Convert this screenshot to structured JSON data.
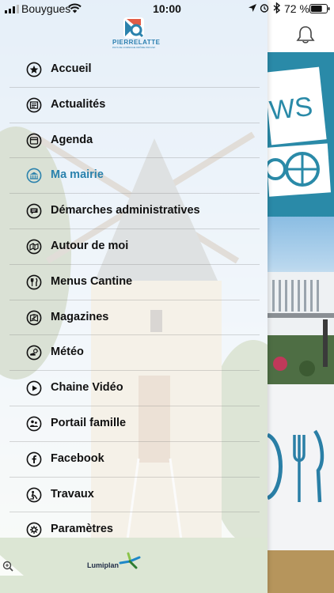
{
  "status_bar": {
    "carrier": "Bouygues",
    "time": "10:00",
    "battery_percent": "72 %",
    "battery_level": 0.72
  },
  "brand": {
    "name": "PIERRELATTE",
    "tagline": "PAYS DE CORNICHE DRÔME PROVENÇALE",
    "accent_color": "#2b82ad"
  },
  "menu": {
    "items": [
      {
        "label": "Accueil",
        "icon": "star-icon",
        "active": false
      },
      {
        "label": "Actualités",
        "icon": "newspaper-icon",
        "active": false
      },
      {
        "label": "Agenda",
        "icon": "calendar-icon",
        "active": false
      },
      {
        "label": "Ma mairie",
        "icon": "town-hall-icon",
        "active": true
      },
      {
        "label": "Démarches administratives",
        "icon": "chat-icon",
        "active": false
      },
      {
        "label": "Autour de moi",
        "icon": "map-icon",
        "active": false
      },
      {
        "label": "Menus Cantine",
        "icon": "cutlery-icon",
        "active": false
      },
      {
        "label": "Magazines",
        "icon": "magazine-icon",
        "active": false
      },
      {
        "label": "Météo",
        "icon": "weather-icon",
        "active": false
      },
      {
        "label": "Chaine Vidéo",
        "icon": "play-icon",
        "active": false
      },
      {
        "label": "Portail famille",
        "icon": "family-icon",
        "active": false
      },
      {
        "label": "Facebook",
        "icon": "facebook-icon",
        "active": false
      },
      {
        "label": "Travaux",
        "icon": "worker-icon",
        "active": false
      },
      {
        "label": "Paramètres",
        "icon": "gear-icon",
        "active": false
      }
    ]
  },
  "footer": {
    "brand": "Lumiplan"
  },
  "background_app": {
    "news_tile_text": "WS"
  }
}
